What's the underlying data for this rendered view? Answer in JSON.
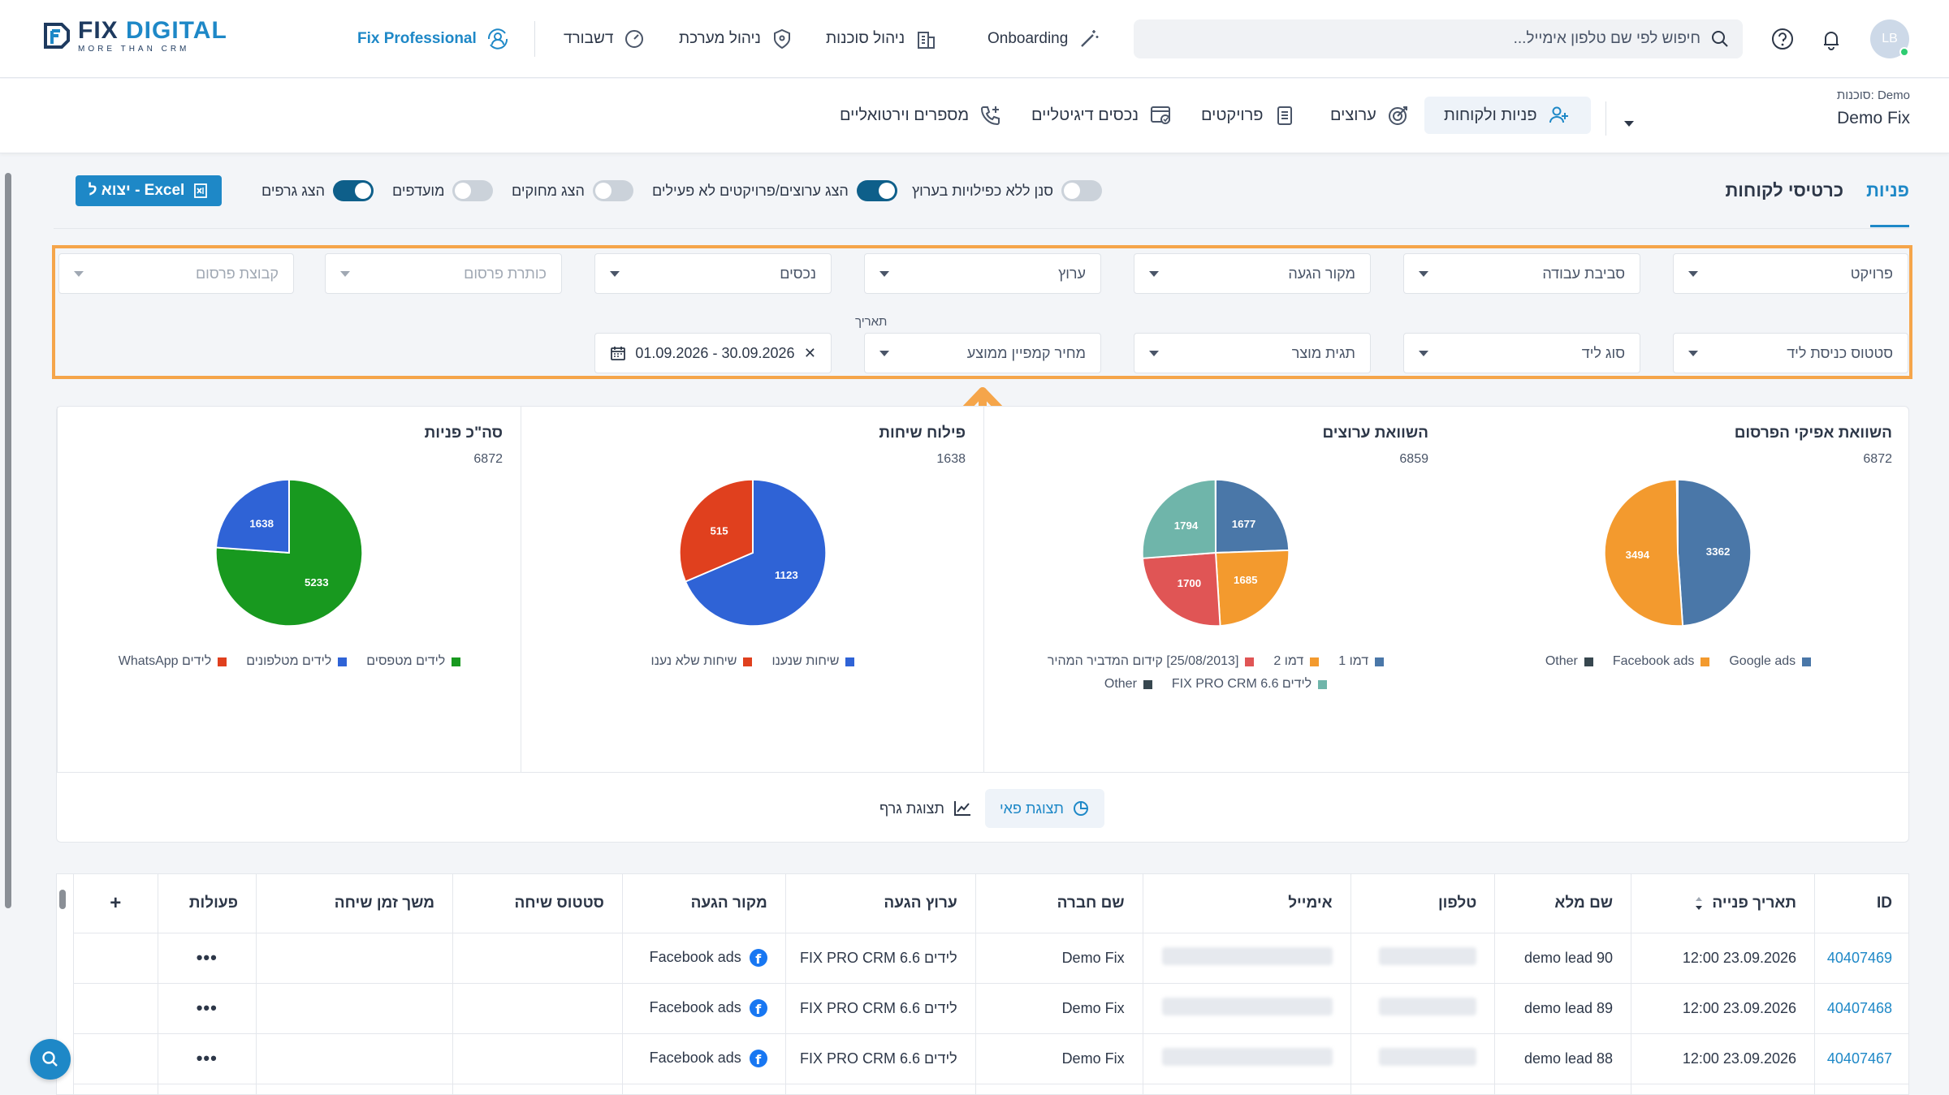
{
  "header": {
    "logo_main": "FIX",
    "logo_accent": "DIGITAL",
    "logo_tagline": "MORE THAN CRM",
    "fix_professional": "Fix Professional",
    "nav": [
      "דשבורד",
      "ניהול מערכת",
      "ניהול סוכנות",
      "Onboarding"
    ],
    "search_placeholder": "חיפוש לפי שם טלפון אימייל...",
    "avatar_initials": "LB"
  },
  "subbar": {
    "account_label": "סוכנות: Demo",
    "account_name": "Demo Fix",
    "nav": [
      "פניות ולקוחות",
      "ערוצים",
      "פרויקטים",
      "נכסים דיגיטליים",
      "מספרים וירטואליים"
    ]
  },
  "tabs": {
    "active": "פניות",
    "other": "כרטיסי לקוחות"
  },
  "toolbar": {
    "toggles": [
      {
        "label": "סנן ללא כפילויות בערוץ",
        "on": false
      },
      {
        "label": "הצג ערוצים/פרויקטים לא פעילים",
        "on": true
      },
      {
        "label": "הצג מחוקים",
        "on": false
      },
      {
        "label": "מועדפים",
        "on": false
      },
      {
        "label": "הצג גרפים",
        "on": true
      }
    ],
    "excel_label": "יצוא ל - Excel"
  },
  "filters": {
    "row1": [
      "פרויקט",
      "סביבת עבודה",
      "מקור הגעה",
      "ערוץ",
      "נכסים",
      "כותרת פרסום",
      "קבוצת פרסום"
    ],
    "row2": [
      "סטטוס כניסת ליד",
      "סוג ליד",
      "תגית מוצר",
      "מחיר קמפיין ממוצע"
    ],
    "date_label": "תאריך",
    "date_value": "01.09.2026 - 30.09.2026"
  },
  "charts": [
    {
      "title": "השוואת אפיקי הפרסום",
      "total": "6872",
      "slices": [
        {
          "label": "Google ads",
          "value": 3362,
          "color": "#4a77a8"
        },
        {
          "label": "Facebook ads",
          "value": 3494,
          "color": "#f39a2e"
        },
        {
          "label": "Other",
          "value": 16,
          "color": "#37474f"
        }
      ]
    },
    {
      "title": "השוואת ערוצים",
      "total": "6859",
      "slices": [
        {
          "label": "דמו 1",
          "value": 1677,
          "color": "#4a77a8"
        },
        {
          "label": "דמו 2",
          "value": 1685,
          "color": "#f39a2e"
        },
        {
          "label": "[25/08/2013] קידום המדביר המהיר",
          "value": 1700,
          "color": "#e05555"
        },
        {
          "label": "לידים FIX PRO CRM 6.6",
          "value": 1794,
          "color": "#6fb5aa"
        },
        {
          "label": "Other",
          "value": 3,
          "color": "#37474f"
        }
      ]
    },
    {
      "title": "פילוח שיחות",
      "total": "1638",
      "slices": [
        {
          "label": "שיחות שנענו",
          "value": 1123,
          "color": "#2f63d6"
        },
        {
          "label": "שיחות שלא נענו",
          "value": 515,
          "color": "#e0401e"
        }
      ]
    },
    {
      "title": "סה\"כ פניות",
      "total": "6872",
      "slices": [
        {
          "label": "לידים מטפסים",
          "value": 5233,
          "color": "#18991f"
        },
        {
          "label": "לידים מטלפונים",
          "value": 1638,
          "color": "#2f63d6"
        },
        {
          "label": "לידים WhatsApp",
          "value": 1,
          "color": "#e0401e"
        }
      ]
    }
  ],
  "view_toggle": {
    "pie": "תצוגת פאי",
    "graph": "תצוגת גרף"
  },
  "table": {
    "columns": [
      "ID",
      "תאריך פנייה",
      "שם מלא",
      "טלפון",
      "אימייל",
      "שם חברה",
      "ערוץ הגעה",
      "מקור הגעה",
      "סטטוס שיחה",
      "משך זמן שיחה",
      "פעולות",
      "+"
    ],
    "rows": [
      {
        "id": "40407469",
        "date": "23.09.2026 12:00",
        "name": "demo lead 90",
        "company": "Demo Fix",
        "channel": "לידים FIX PRO CRM 6.6",
        "source": "Facebook ads"
      },
      {
        "id": "40407468",
        "date": "23.09.2026 12:00",
        "name": "demo lead 89",
        "company": "Demo Fix",
        "channel": "לידים FIX PRO CRM 6.6",
        "source": "Facebook ads"
      },
      {
        "id": "40407467",
        "date": "23.09.2026 12:00",
        "name": "demo lead 88",
        "company": "Demo Fix",
        "channel": "לידים FIX PRO CRM 6.6",
        "source": "Facebook ads"
      },
      {
        "id": "",
        "date": "",
        "name": "",
        "company": "",
        "channel": "",
        "source": ""
      }
    ],
    "actions_glyph": "•••"
  },
  "colors": {
    "accent": "#1e88c7",
    "highlight": "#f5a54a"
  }
}
